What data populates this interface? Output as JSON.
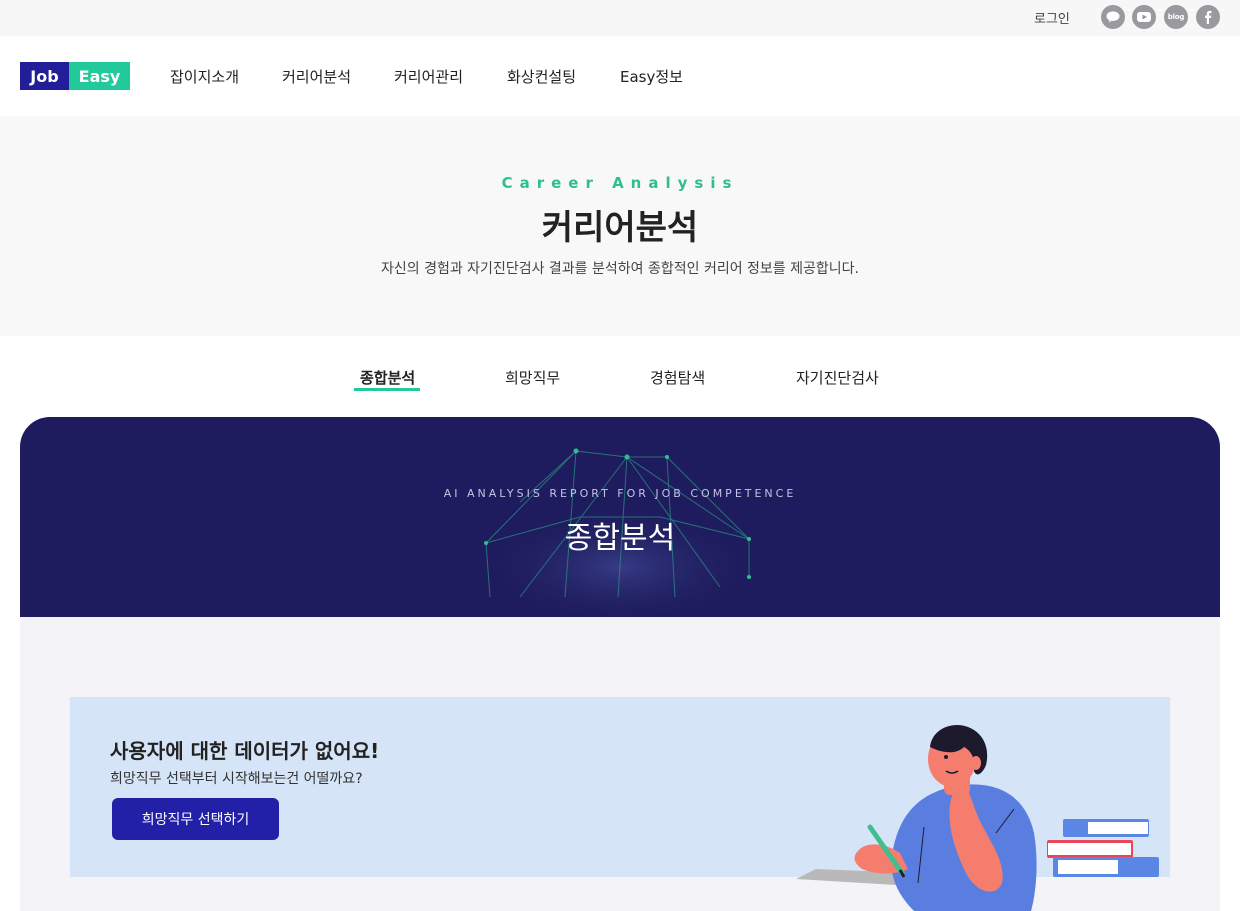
{
  "util_bar": {
    "login_label": "로그인",
    "social_icons": [
      "kakao-talk-icon",
      "youtube-icon",
      "blog-icon",
      "facebook-icon"
    ],
    "blog_text": "blog"
  },
  "logo": {
    "part1": "Job",
    "part2": "Easy",
    "part1_color": "#221e9a",
    "part2_color": "#22c99a"
  },
  "nav": {
    "items": [
      {
        "label": "잡이지소개"
      },
      {
        "label": "커리어분석"
      },
      {
        "label": "커리어관리"
      },
      {
        "label": "화상컨설팅"
      },
      {
        "label": "Easy정보"
      }
    ]
  },
  "hero": {
    "eyebrow": "Career Analysis",
    "title": "커리어분석",
    "description": "자신의 경험과 자기진단검사 결과를 분석하여 종합적인 커리어 정보를 제공합니다."
  },
  "tabs": {
    "items": [
      {
        "label": "종합분석",
        "active": true
      },
      {
        "label": "희망직무",
        "active": false
      },
      {
        "label": "경험탐색",
        "active": false
      },
      {
        "label": "자기진단검사",
        "active": false
      }
    ]
  },
  "report": {
    "eyebrow": "AI ANALYSIS REPORT FOR JOB COMPETENCE",
    "title": "종합분석"
  },
  "empty_state": {
    "title": "사용자에 대한 데이터가 없어요!",
    "subtitle": "희망직무 선택부터 시작해보는건 어떨까요?",
    "button_label": "희망직무 선택하기"
  },
  "colors": {
    "accent_green": "#22c99a",
    "brand_navy": "#221e9a",
    "report_header_bg": "#1e1c5e",
    "empty_card_bg": "#d5e4f7"
  }
}
